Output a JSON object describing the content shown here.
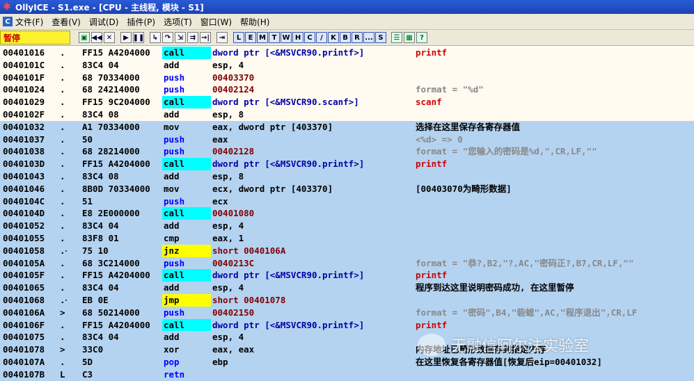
{
  "window": {
    "title": "OllyICE - S1.exe - [CPU - 主线程, 模块 - S1]",
    "app_icon": "bug-icon"
  },
  "menu": [
    "文件(F)",
    "查看(V)",
    "调试(D)",
    "插件(P)",
    "选项(T)",
    "窗口(W)",
    "帮助(H)"
  ],
  "toolbar": {
    "status": "暂停",
    "letters": [
      "L",
      "E",
      "M",
      "T",
      "W",
      "H",
      "C",
      "/",
      "K",
      "B",
      "R",
      "...",
      "S"
    ]
  },
  "rows": [
    {
      "addr": "00401016",
      "mark": ".",
      "hex": "FF15 A4204000",
      "hex_ul": "",
      "mnem": "call",
      "op": "dword ptr [<&MSVCR90.printf>]",
      "style": "norm",
      "cm": "printf"
    },
    {
      "addr": "0040101C",
      "mark": ".",
      "hex": "83C4 04",
      "hex_ul": "",
      "mnem": "add",
      "op": "esp, 4",
      "style": "norm",
      "cm": ""
    },
    {
      "addr": "0040101F",
      "mark": ".",
      "hex": "68 70334000",
      "hex_ul": "70334000",
      "mnem": "push",
      "op": "00403370",
      "style": "norm",
      "cm": ""
    },
    {
      "addr": "00401024",
      "mark": ".",
      "hex": "68 24214000",
      "hex_ul": "24214000",
      "mnem": "push",
      "op": "00402124",
      "style": "norm",
      "cm": "format = \"%d\""
    },
    {
      "addr": "00401029",
      "mark": ".",
      "hex": "FF15 9C204000",
      "hex_ul": "",
      "mnem": "call",
      "op": "dword ptr [<&MSVCR90.scanf>]",
      "style": "norm",
      "cm": "scanf"
    },
    {
      "addr": "0040102F",
      "mark": ".",
      "hex": "83C4 08",
      "hex_ul": "",
      "mnem": "add",
      "op": "esp, 8",
      "style": "norm",
      "cm": ""
    },
    {
      "addr": "00401032",
      "mark": ".",
      "hex": "A1 70334000",
      "hex_ul": "70334000",
      "mnem": "mov",
      "op": "eax, dword ptr [403370]",
      "style": "sel",
      "cm": "选择在这里保存各寄存器值"
    },
    {
      "addr": "00401037",
      "mark": ".",
      "hex": "50",
      "hex_ul": "",
      "mnem": "push",
      "op": "eax",
      "style": "sel",
      "cm": "<%d> => 0"
    },
    {
      "addr": "00401038",
      "mark": ".",
      "hex": "68 28214000",
      "hex_ul": "28214000",
      "mnem": "push",
      "op": "00402128",
      "style": "sel",
      "cm": "format = \"您输入的密码是%d,\",CR,LF,\"\""
    },
    {
      "addr": "0040103D",
      "mark": ".",
      "hex": "FF15 A4204000",
      "hex_ul": "",
      "mnem": "call",
      "op": "dword ptr [<&MSVCR90.printf>]",
      "style": "sel",
      "cm": "printf"
    },
    {
      "addr": "00401043",
      "mark": ".",
      "hex": "83C4 08",
      "hex_ul": "",
      "mnem": "add",
      "op": "esp, 8",
      "style": "sel",
      "cm": ""
    },
    {
      "addr": "00401046",
      "mark": ".",
      "hex": "8B0D 70334000",
      "hex_ul": "",
      "mnem": "mov",
      "op": "ecx, dword ptr [403370]",
      "style": "sel",
      "cm": "[00403070为畸形数据]"
    },
    {
      "addr": "0040104C",
      "mark": ".",
      "hex": "51",
      "hex_ul": "",
      "mnem": "push",
      "op": "ecx",
      "style": "sel",
      "cm": ""
    },
    {
      "addr": "0040104D",
      "mark": ".",
      "hex": "E8 2E000000",
      "hex_ul": "",
      "mnem": "call",
      "op": "00401080",
      "style": "sel",
      "cm": ""
    },
    {
      "addr": "00401052",
      "mark": ".",
      "hex": "83C4 04",
      "hex_ul": "",
      "mnem": "add",
      "op": "esp, 4",
      "style": "sel",
      "cm": ""
    },
    {
      "addr": "00401055",
      "mark": ".",
      "hex": "83F8 01",
      "hex_ul": "",
      "mnem": "cmp",
      "op": "eax, 1",
      "style": "sel",
      "cm": ""
    },
    {
      "addr": "00401058",
      "mark": ".~",
      "hex": "75 10",
      "hex_ul": "",
      "mnem": "jnz",
      "op": "short 0040106A",
      "style": "sel",
      "cm": ""
    },
    {
      "addr": "0040105A",
      "mark": ".",
      "hex": "68 3C214000",
      "hex_ul": "3C214000",
      "mnem": "push",
      "op": "0040213C",
      "style": "sel",
      "cm": "format = \"恭?,B2,\"?,AC,\"密码正?,B7,CR,LF,\"\""
    },
    {
      "addr": "0040105F",
      "mark": ".",
      "hex": "FF15 A4204000",
      "hex_ul": "",
      "mnem": "call",
      "op": "dword ptr [<&MSVCR90.printf>]",
      "style": "sel",
      "cm": "printf"
    },
    {
      "addr": "00401065",
      "mark": ".",
      "hex": "83C4 04",
      "hex_ul": "",
      "mnem": "add",
      "op": "esp, 4",
      "style": "sel",
      "cm": "程序到达这里说明密码成功, 在这里暂停"
    },
    {
      "addr": "00401068",
      "mark": ".~",
      "hex": "EB 0E",
      "hex_ul": "",
      "mnem": "jmp",
      "op": "short 00401078",
      "style": "sel",
      "cm": ""
    },
    {
      "addr": "0040106A",
      "mark": ">",
      "hex": "68 50214000",
      "hex_ul": "50214000",
      "mnem": "push",
      "op": "00402150",
      "style": "sel",
      "cm": "format = \"密码\",B4,\"砦螅\",AC,\"程序退出\",CR,LF"
    },
    {
      "addr": "0040106F",
      "mark": ".",
      "hex": "FF15 A4204000",
      "hex_ul": "",
      "mnem": "call",
      "op": "dword ptr [<&MSVCR90.printf>]",
      "style": "sel",
      "cm": "printf"
    },
    {
      "addr": "00401075",
      "mark": ".",
      "hex": "83C4 04",
      "hex_ul": "",
      "mnem": "add",
      "op": "esp, 4",
      "style": "sel",
      "cm": ""
    },
    {
      "addr": "00401078",
      "mark": ">",
      "hex": "33C0",
      "hex_ul": "",
      "mnem": "xor",
      "op": "eax, eax",
      "style": "sel",
      "cm": "内存地址已畸形数据存到指定内存"
    },
    {
      "addr": "0040107A",
      "mark": ".",
      "hex": "5D",
      "hex_ul": "",
      "mnem": "pop",
      "op": "ebp",
      "style": "sel",
      "cm": "在这里恢复各寄存器值[恢复后eip=00401032]"
    },
    {
      "addr": "0040107B",
      "mark": "L.",
      "hex": "C3",
      "hex_ul": "",
      "mnem": "retn",
      "op": "",
      "style": "sel",
      "cm": ""
    }
  ],
  "watermark": "无融信阿尔法实验室",
  "colors": {
    "call_bg": "#00ffff",
    "jmp_bg": "#ffff00",
    "selection": "#b4d3f0"
  }
}
